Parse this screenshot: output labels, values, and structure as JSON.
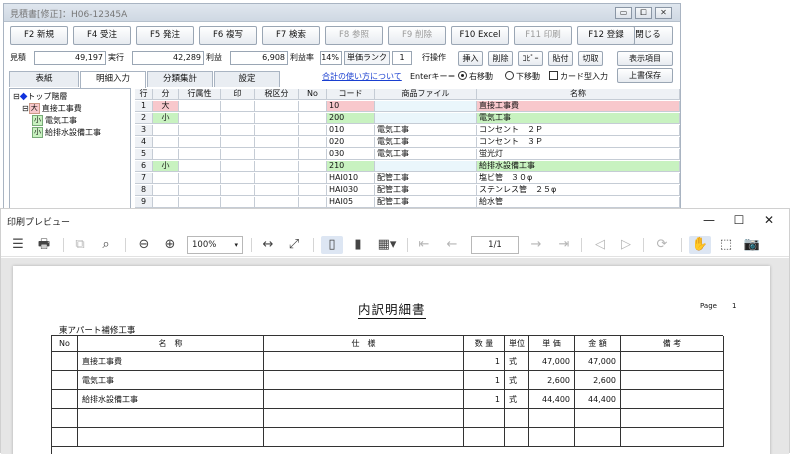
{
  "back_window": {
    "title": "見積書[修正]：H06-12345A",
    "window_controls": [
      "▭",
      "⧠",
      "✕"
    ],
    "function_buttons": [
      {
        "label": "F2 新規",
        "enabled": true
      },
      {
        "label": "F4 受注",
        "enabled": true
      },
      {
        "label": "F5 発注",
        "enabled": true
      },
      {
        "label": "F6 複写",
        "enabled": true
      },
      {
        "label": "F7 検索",
        "enabled": true
      },
      {
        "label": "F8 参照",
        "enabled": false
      },
      {
        "label": "F9 削除",
        "enabled": false
      },
      {
        "label": "F10 Excel",
        "enabled": true
      },
      {
        "label": "F11 印刷",
        "enabled": false
      },
      {
        "label": "F12 登録",
        "enabled": true
      }
    ],
    "close_label": "閉じる",
    "summary": {
      "estimate_label": "見積",
      "estimate_value": "49,197",
      "actual_label": "実行",
      "actual_value": "42,289",
      "profit_label": "利益",
      "profit_value": "6,908",
      "rate_label": "利益率",
      "rate_value": "14%",
      "unit_rank_label": "単価ランク",
      "unit_rank_value": "1",
      "row_ops_label": "行操作",
      "row_buttons": [
        "挿入",
        "削除",
        "ｺﾋﾟｰ",
        "貼付",
        "切取"
      ],
      "display_items_label": "表示項目",
      "overwrite_label": "上書保存"
    },
    "tabs": [
      "表紙",
      "明細入力",
      "分類集計",
      "設定"
    ],
    "help_link": "合計の使い方について",
    "enter_key_label": "Enterキー＝",
    "radio_right": "右移動",
    "radio_down": "下移動",
    "card_input_label": "カード型入力",
    "tree": {
      "root": "トップ階層",
      "items": [
        {
          "badge": "大",
          "label": "直接工事費"
        },
        {
          "badge": "小",
          "label": "電気工事"
        },
        {
          "badge": "小",
          "label": "給排水設備工事"
        }
      ]
    },
    "grid": {
      "columns": [
        "行",
        "分",
        "行属性",
        "印",
        "税区分",
        "No",
        "コード",
        "商品ファイル",
        "名称"
      ],
      "rows": [
        {
          "row": "1",
          "div": "大",
          "code": "10",
          "product": "",
          "name": "直接工事費",
          "color": "#f8c8cc"
        },
        {
          "row": "2",
          "div": "小",
          "code": "200",
          "product": "",
          "name": "電気工事",
          "color": "#c8f2c0"
        },
        {
          "row": "3",
          "div": "",
          "code": "010",
          "product": "電気工事",
          "name": "コンセント　２Ｐ",
          "color": "#ffffff"
        },
        {
          "row": "4",
          "div": "",
          "code": "020",
          "product": "電気工事",
          "name": "コンセント　３Ｐ",
          "color": "#ffffff"
        },
        {
          "row": "5",
          "div": "",
          "code": "030",
          "product": "電気工事",
          "name": "蛍光灯",
          "color": "#ffffff"
        },
        {
          "row": "6",
          "div": "小",
          "code": "210",
          "product": "",
          "name": "給排水設備工事",
          "color": "#c8f2c0"
        },
        {
          "row": "7",
          "div": "",
          "code": "HAI010",
          "product": "配管工事",
          "name": "塩ビ管　３０φ",
          "color": "#ffffff"
        },
        {
          "row": "8",
          "div": "",
          "code": "HAI030",
          "product": "配管工事",
          "name": "ステンレス管　２５φ",
          "color": "#ffffff"
        },
        {
          "row": "9",
          "div": "",
          "code": "HAI05",
          "product": "配管工事",
          "name": "給水管",
          "color": "#ffffff"
        }
      ]
    }
  },
  "preview_window": {
    "title": "印刷プレビュー",
    "controls": [
      "—",
      "☐",
      "✕"
    ],
    "zoom": "100%",
    "page_indicator": "1/1",
    "report": {
      "title": "内訳明細書",
      "page_label": "Page",
      "page_number": "1",
      "project": "東アパート補修工事",
      "columns": [
        "No",
        "名　称",
        "仕　様",
        "数 量",
        "単位",
        "単 価",
        "金 額",
        "備 考"
      ],
      "rows": [
        {
          "no": "",
          "name": "直接工事費",
          "spec": "",
          "qty": "1",
          "unit": "式",
          "price": "47,000",
          "amount": "47,000",
          "note": ""
        },
        {
          "no": "",
          "name": "電気工事",
          "spec": "",
          "qty": "1",
          "unit": "式",
          "price": "2,600",
          "amount": "2,600",
          "note": ""
        },
        {
          "no": "",
          "name": "給排水設備工事",
          "spec": "",
          "qty": "1",
          "unit": "式",
          "price": "44,400",
          "amount": "44,400",
          "note": ""
        },
        {
          "no": "",
          "name": "",
          "spec": "",
          "qty": "",
          "unit": "",
          "price": "",
          "amount": "",
          "note": ""
        },
        {
          "no": "",
          "name": "",
          "spec": "",
          "qty": "",
          "unit": "",
          "price": "",
          "amount": "",
          "note": ""
        }
      ]
    }
  }
}
